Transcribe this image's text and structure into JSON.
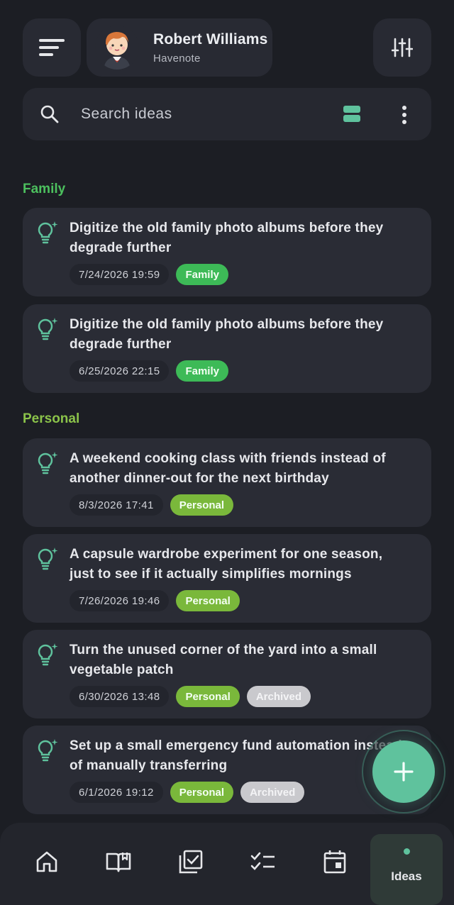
{
  "header": {
    "user_name": "Robert Williams",
    "app_name": "Havenote"
  },
  "search": {
    "placeholder": "Search ideas"
  },
  "colors": {
    "accent": "#5fc29d",
    "family_label": "#4cc05e",
    "personal_label": "#8bc34a",
    "family_tag": "#3dba57",
    "personal_tag": "#7ab83b",
    "archived_tag": "#c9c9cd"
  },
  "sections": [
    {
      "label": "Family",
      "ideas": [
        {
          "title": "Digitize the old family photo albums before they degrade further",
          "date": "7/24/2026 19:59",
          "tags": [
            "Family"
          ]
        },
        {
          "title": "Digitize the old family photo albums before they degrade further",
          "date": "6/25/2026 22:15",
          "tags": [
            "Family"
          ]
        }
      ]
    },
    {
      "label": "Personal",
      "ideas": [
        {
          "title": "A weekend cooking class with friends instead of another dinner-out for the next birthday",
          "date": "8/3/2026 17:41",
          "tags": [
            "Personal"
          ]
        },
        {
          "title": "A capsule wardrobe experiment for one season, just to see if it actually simplifies mornings",
          "date": "7/26/2026 19:46",
          "tags": [
            "Personal"
          ]
        },
        {
          "title": "Turn the unused corner of the yard into a small vegetable patch",
          "date": "6/30/2026 13:48",
          "tags": [
            "Personal",
            "Archived"
          ]
        },
        {
          "title": "Set up a small emergency fund automation instead of manually transferring",
          "date": "6/1/2026 19:12",
          "tags": [
            "Personal",
            "Archived"
          ]
        }
      ]
    }
  ],
  "bottom_nav": {
    "items": [
      {
        "icon": "home-icon"
      },
      {
        "icon": "book-icon"
      },
      {
        "icon": "checkbox-icon"
      },
      {
        "icon": "checklist-icon"
      },
      {
        "icon": "calendar-icon"
      }
    ],
    "active_label": "Ideas"
  }
}
